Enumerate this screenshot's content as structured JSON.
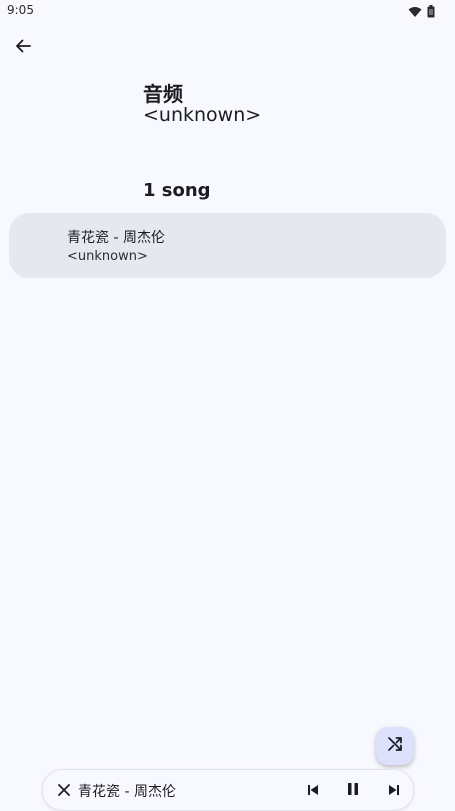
{
  "status_bar": {
    "time": "9:05",
    "icons": [
      "wifi-icon",
      "battery-icon"
    ]
  },
  "nav": {
    "back_icon": "arrow-left-icon"
  },
  "album": {
    "title": "音频",
    "artist": "<unknown>"
  },
  "songs": {
    "count_label": "1 song",
    "items": [
      {
        "title": "青花瓷 - 周杰伦",
        "artist": "<unknown>"
      }
    ]
  },
  "fab": {
    "icon": "shuffle-icon"
  },
  "mini_player": {
    "title": "青花瓷 - 周杰伦",
    "close_icon": "close-icon",
    "prev_icon": "skip-previous-icon",
    "play_state_icon": "pause-icon",
    "next_icon": "skip-next-icon"
  },
  "colors": {
    "background": "#f8f9ff",
    "card": "#e6e8f0",
    "fab": "#dde1fb"
  }
}
